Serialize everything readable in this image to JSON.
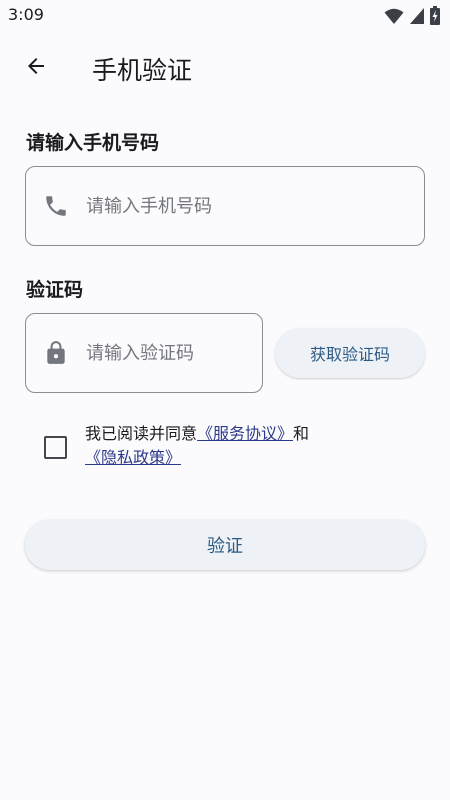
{
  "status_bar": {
    "time": "3:09",
    "icons": [
      "wifi-icon",
      "signal-icon",
      "battery-icon"
    ]
  },
  "app_bar": {
    "title": "手机验证",
    "back_icon": "arrow-back-icon"
  },
  "phone": {
    "label": "请输入手机号码",
    "placeholder": "请输入手机号码",
    "value": "",
    "icon": "phone-icon"
  },
  "code": {
    "label": "验证码",
    "placeholder": "请输入验证码",
    "value": "",
    "icon": "lock-icon",
    "get_code_label": "获取验证码"
  },
  "agreement": {
    "checked": false,
    "prefix": "我已阅读并同意",
    "terms_link": "《服务协议》",
    "conjunction": "和",
    "privacy_link": "《隐私政策》"
  },
  "verify_button": {
    "label": "验证"
  },
  "colors": {
    "background": "#fbfbfe",
    "accent_text": "#2b5a84",
    "link": "#2d3a8c",
    "button_bg": "#eef2f7",
    "outline": "#8b8d95"
  }
}
